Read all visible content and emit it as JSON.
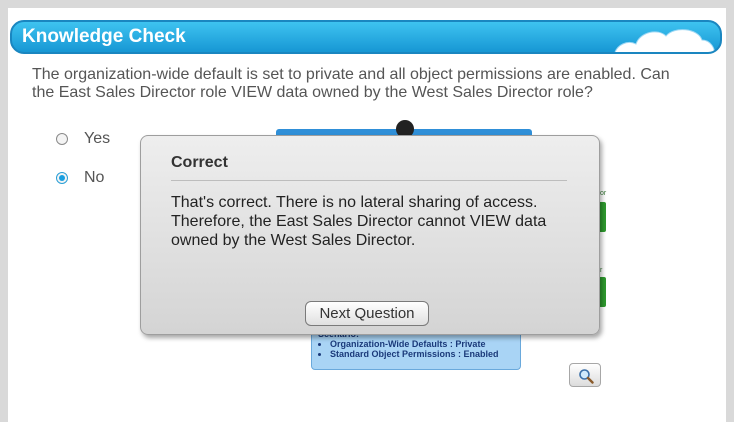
{
  "header": {
    "title": "Knowledge Check",
    "decoration": "cloud-icon"
  },
  "question": {
    "text": "The organization-wide default is set to private and all object permissions are enabled. Can the East Sales Director role VIEW data owned by the West Sales Director role?"
  },
  "options": [
    {
      "label": "Yes",
      "selected": false
    },
    {
      "label": "No",
      "selected": true
    }
  ],
  "diagram": {
    "partial_labels": [
      "or",
      "r"
    ],
    "scenario_title": "Scenario:",
    "scenario_items": [
      "Organization-Wide Defaults : Private",
      "Standard Object Permissions : Enabled"
    ],
    "zoom_icon": "magnifier-icon"
  },
  "feedback": {
    "title": "Correct",
    "body": "That's correct. There is no lateral sharing of access. Therefore, the East Sales Director cannot VIEW data owned by the West Sales Director.",
    "next_label": "Next Question"
  },
  "colors": {
    "title_bar": "#1797d4",
    "radio_selected": "#1a9fe0",
    "scenario_bg": "#a9d4f5"
  }
}
